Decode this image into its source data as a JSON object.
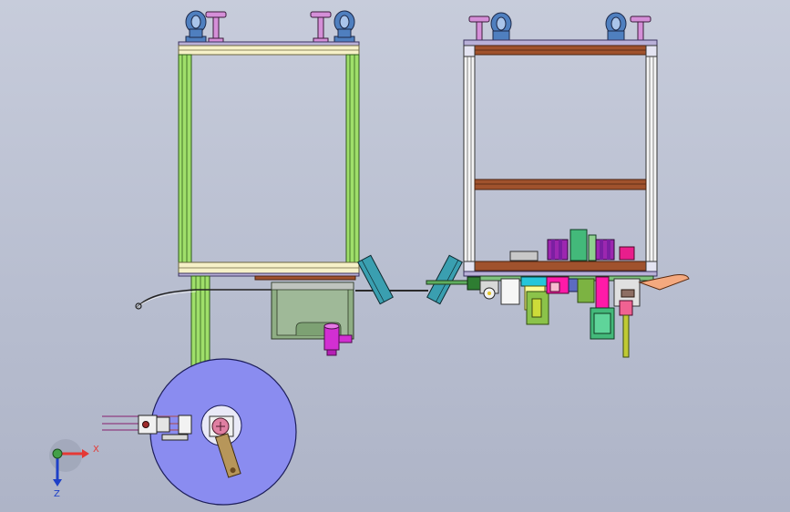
{
  "viewer": {
    "background_top": "#c7ccdb",
    "background_bottom": "#aeb4c7"
  },
  "triad": {
    "x_label": "X",
    "z_label": "Z",
    "x_color": "#e53935",
    "y_color": "#43a047",
    "z_color": "#1e40c8"
  },
  "colors": {
    "frame_green": "#9fdf6a",
    "frame_edge": "#2f5a1a",
    "white_frame": "#f4f4f4",
    "brown_bar": "#a0522d",
    "blue_wheel": "#8a8cf0",
    "pink_part": "#d58fd8",
    "magenta_part": "#d22fd2",
    "teal_plate": "#3a9fb0",
    "caster_blue": "#4f7fbf",
    "cream_bar": "#f6f1c8"
  }
}
